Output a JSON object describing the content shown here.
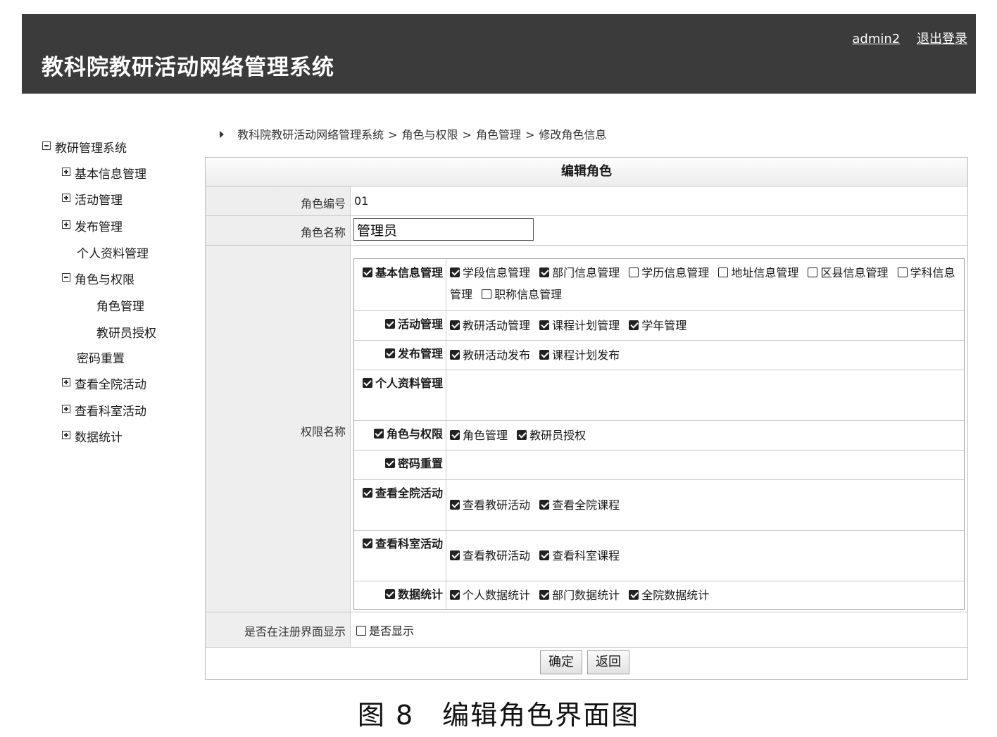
{
  "header": {
    "title": "教科院教研活动网络管理系统",
    "user": "admin2",
    "logout": "退出登录"
  },
  "sidebar": {
    "items": [
      {
        "label": "教研管理系统",
        "expander": "minus"
      },
      {
        "label": "基本信息管理",
        "expander": "plus"
      },
      {
        "label": "活动管理",
        "expander": "plus"
      },
      {
        "label": "发布管理",
        "expander": "plus"
      },
      {
        "label": "个人资料管理",
        "expander": "none"
      },
      {
        "label": "角色与权限",
        "expander": "minus"
      },
      {
        "label": "角色管理",
        "expander": "none"
      },
      {
        "label": "教研员授权",
        "expander": "none"
      },
      {
        "label": "密码重置",
        "expander": "none"
      },
      {
        "label": "查看全院活动",
        "expander": "plus"
      },
      {
        "label": "查看科室活动",
        "expander": "plus"
      },
      {
        "label": "数据统计",
        "expander": "plus"
      }
    ]
  },
  "breadcrumb": [
    "教科院教研活动网络管理系统",
    "角色与权限",
    "角色管理",
    "修改角色信息"
  ],
  "breadcrumb_sep": ">",
  "form": {
    "title": "编辑角色",
    "role_id_label": "角色编号",
    "role_id": "01",
    "role_name_label": "角色名称",
    "role_name": "管理员",
    "perm_label": "权限名称",
    "register_label": "是否在注册界面显示",
    "register_option": "是否显示",
    "register_checked": false,
    "confirm": "确定",
    "back": "返回"
  },
  "permissions": [
    {
      "category": "基本信息管理",
      "checked": true,
      "subs": [
        {
          "label": "学段信息管理",
          "checked": true
        },
        {
          "label": "部门信息管理",
          "checked": true
        },
        {
          "label": "学历信息管理",
          "checked": false
        },
        {
          "label": "地址信息管理",
          "checked": false
        },
        {
          "label": "区县信息管理",
          "checked": false
        },
        {
          "label": "学科信息管理",
          "checked": false
        },
        {
          "label": "职称信息管理",
          "checked": false
        }
      ]
    },
    {
      "category": "活动管理",
      "checked": true,
      "subs": [
        {
          "label": "教研活动管理",
          "checked": true
        },
        {
          "label": "课程计划管理",
          "checked": true
        },
        {
          "label": "学年管理",
          "checked": true
        }
      ]
    },
    {
      "category": "发布管理",
      "checked": true,
      "subs": [
        {
          "label": "教研活动发布",
          "checked": true
        },
        {
          "label": "课程计划发布",
          "checked": true
        }
      ]
    },
    {
      "category": "个人资料管理",
      "checked": true,
      "subs": []
    },
    {
      "category": "角色与权限",
      "checked": true,
      "subs": [
        {
          "label": "角色管理",
          "checked": true
        },
        {
          "label": "教研员授权",
          "checked": true
        }
      ]
    },
    {
      "category": "密码重置",
      "checked": true,
      "subs": []
    },
    {
      "category": "查看全院活动",
      "checked": true,
      "subs": [
        {
          "label": "查看教研活动",
          "checked": true
        },
        {
          "label": "查看全院课程",
          "checked": true
        }
      ]
    },
    {
      "category": "查看科室活动",
      "checked": true,
      "subs": [
        {
          "label": "查看教研活动",
          "checked": true
        },
        {
          "label": "查看科室课程",
          "checked": true
        }
      ]
    },
    {
      "category": "数据统计",
      "checked": true,
      "subs": [
        {
          "label": "个人数据统计",
          "checked": true
        },
        {
          "label": "部门数据统计",
          "checked": true
        },
        {
          "label": "全院数据统计",
          "checked": true
        }
      ]
    }
  ],
  "caption": "图 8　编辑角色界面图"
}
